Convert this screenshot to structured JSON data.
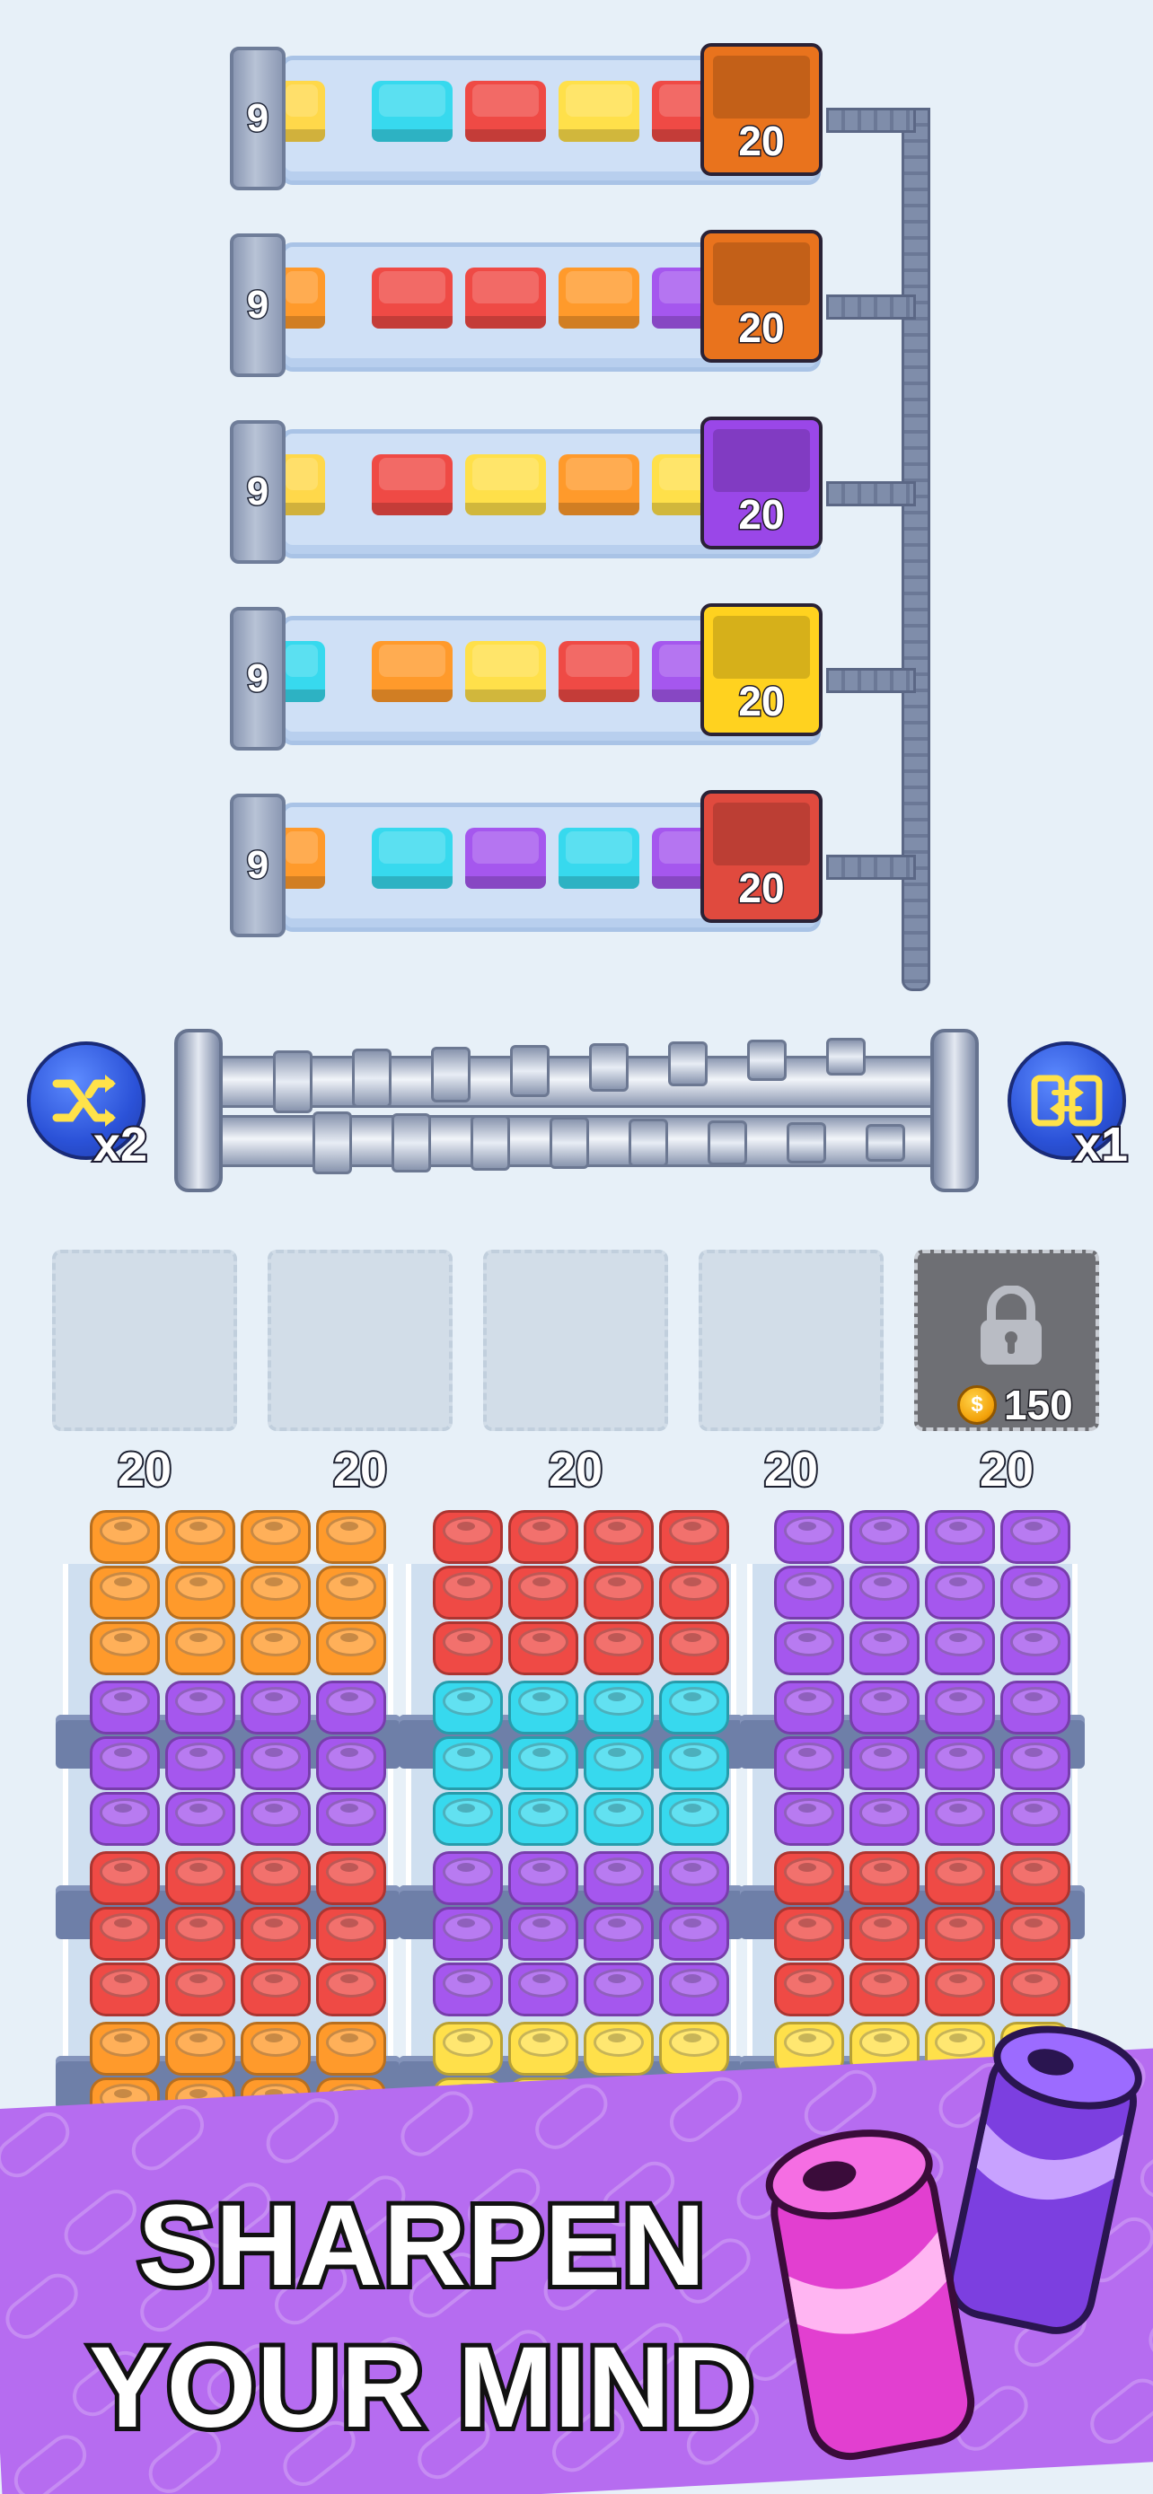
{
  "rows": [
    {
      "count": "9",
      "target_count": "20",
      "target_color": "#e9731d",
      "slots": [
        "#ffd84a",
        "#37d9ee",
        "#ef4a45",
        "#ffe04a",
        "#ef4a45"
      ]
    },
    {
      "count": "9",
      "target_count": "20",
      "target_color": "#e9731d",
      "slots": [
        "#ff9a2b",
        "#ef4a45",
        "#ef4a45",
        "#ff9a2b",
        "#a557ee"
      ]
    },
    {
      "count": "9",
      "target_count": "20",
      "target_color": "#9a47e8",
      "slots": [
        "#ffd84a",
        "#ef4a45",
        "#ffe04a",
        "#ff9a2b",
        "#ffe04a"
      ]
    },
    {
      "count": "9",
      "target_count": "20",
      "target_color": "#ffd21f",
      "slots": [
        "#37d9ee",
        "#ff9a2b",
        "#ffe04a",
        "#ef4a45",
        "#a557ee"
      ]
    },
    {
      "count": "9",
      "target_count": "20",
      "target_color": "#e04a3e",
      "slots": [
        "#ff9a2b",
        "#37d9ee",
        "#a557ee",
        "#37d9ee",
        "#a557ee"
      ]
    }
  ],
  "powerups": {
    "shuffle": {
      "icon": "shuffle-icon",
      "label": "x2"
    },
    "swap": {
      "icon": "swap-icon",
      "label": "x1"
    }
  },
  "locked_slot": {
    "price": "150",
    "coin_symbol": "$"
  },
  "counts": [
    "20",
    "20",
    "20",
    "20",
    "20"
  ],
  "shelves": [
    {
      "tiers": [
        "#ff9a2b",
        "#a557ee",
        "#ef4a45",
        "#ff9a2b"
      ]
    },
    {
      "tiers": [
        "#ef4a45",
        "#37d9ee",
        "#a557ee",
        "#ffe04a"
      ]
    },
    {
      "tiers": [
        "#a557ee",
        "#a557ee",
        "#ef4a45",
        "#ffe04a"
      ]
    }
  ],
  "banner": {
    "line1": "SHARPEN",
    "line2": "YOUR MIND"
  }
}
